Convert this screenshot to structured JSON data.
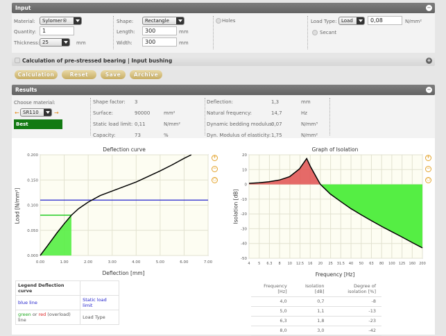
{
  "input": {
    "header": "Input",
    "material_label": "Material:",
    "material_value": "Sylomer®",
    "quantity_label": "Quantity:",
    "quantity_value": "1",
    "thickness_label": "Thickness:",
    "thickness_value": "25",
    "thickness_unit": "mm",
    "shape_label": "Shape:",
    "shape_value": "Rectangle",
    "length_label": "Length:",
    "length_value": "300",
    "length_unit": "mm",
    "width_label": "Width:",
    "width_value": "300",
    "width_unit": "mm",
    "holes_label": "Holes",
    "load_type_label": "Load Type:",
    "load_type_value": "Load",
    "load_value": "0,08",
    "load_unit": "N/mm²",
    "secant_label": "Secant"
  },
  "prestress": {
    "label": "Calculation of pre-stressed bearing | Input bushing"
  },
  "buttons": {
    "calculation": "Calculation",
    "reset": "Reset",
    "save": "Save",
    "archive": "Archive"
  },
  "results": {
    "header": "Results",
    "choose_material_label": "Choose material:",
    "material_value": "SR110",
    "best_label": "Best",
    "col1": [
      {
        "label": "Shape factor:",
        "value": "3",
        "unit": ""
      },
      {
        "label": "Surface:",
        "value": "90000",
        "unit": "mm²"
      },
      {
        "label": "Static load limit:",
        "value": "0,11",
        "unit": "N/mm²"
      },
      {
        "label": "Capacity:",
        "value": "73",
        "unit": "%"
      }
    ],
    "col2": [
      {
        "label": "Deflection:",
        "value": "1,3",
        "unit": "mm"
      },
      {
        "label": "Natural frequency:",
        "value": "14,7",
        "unit": "Hz"
      },
      {
        "label": "Dynamic bedding modulus:",
        "value": "0,07",
        "unit": "N/mm³"
      },
      {
        "label": "Dyn. Modulus of elasticity:",
        "value": "1,75",
        "unit": "N/mm²"
      }
    ]
  },
  "legend": {
    "title": "Legend Deflection curve",
    "row1_left": "blue line",
    "row1_right": "Static load limit",
    "row2_green": "green",
    "row2_or": " or ",
    "row2_red": "red",
    "row2_rest": " (overload) line",
    "row2_right": "Load Type"
  },
  "freq_table": {
    "headers": [
      "Frequency [Hz]",
      "Isolation [dB]",
      "Degree of isolation [%]"
    ],
    "rows": [
      [
        "4,0",
        "0,7",
        "-8"
      ],
      [
        "5,0",
        "1,1",
        "-13"
      ],
      [
        "6,3",
        "1,8",
        "-23"
      ],
      [
        "8,0",
        "3,0",
        "-42"
      ]
    ]
  },
  "colors": {
    "static_limit": "#2222cc",
    "load": "#22cc22",
    "amplification": "#e05050",
    "isolation": "#55ee44"
  },
  "chart_data": [
    {
      "type": "line",
      "title": "Deflection curve",
      "xlabel": "Deflection [mm]",
      "ylabel": "Load [N/mm²]",
      "xlim": [
        0,
        7
      ],
      "ylim": [
        0,
        0.2
      ],
      "xticks": [
        "0.00",
        "1.00",
        "2.00",
        "3.00",
        "4.00",
        "5.00",
        "6.00",
        "7.00"
      ],
      "yticks": [
        "0.000",
        "0.050",
        "0.100",
        "0.150",
        "0.200"
      ],
      "series": [
        {
          "x": [
            0,
            0.3,
            0.7,
            1.0,
            1.3,
            1.6,
            2.0,
            2.5,
            3.0,
            3.5,
            4.0,
            4.5,
            5.0,
            5.5,
            6.0,
            6.3
          ],
          "y": [
            0,
            0.019,
            0.045,
            0.063,
            0.08,
            0.093,
            0.106,
            0.119,
            0.128,
            0.137,
            0.146,
            0.157,
            0.168,
            0.18,
            0.193,
            0.2
          ]
        }
      ],
      "static_load_limit": 0.11,
      "load": 0.08,
      "deflection_at_load": 1.3
    },
    {
      "type": "line",
      "title": "Graph of Isolation",
      "xlabel": "Frequency [Hz]",
      "ylabel": "Isolation [dB]",
      "xticks": [
        "4",
        "5",
        "6.3",
        "8",
        "10",
        "12.5",
        "16",
        "20",
        "25",
        "31.5",
        "40",
        "50",
        "63",
        "80",
        "100",
        "125",
        "160",
        "200"
      ],
      "ylim": [
        -50,
        20
      ],
      "yticks": [
        "20",
        "10",
        "0",
        "-10",
        "-20",
        "-30",
        "-40",
        "-50"
      ],
      "series": [
        {
          "x": [
            4,
            5,
            6.3,
            8,
            10,
            12.5,
            14.7,
            16,
            20,
            25,
            31.5,
            40,
            50,
            63,
            80,
            100,
            125,
            160,
            200
          ],
          "y": [
            0.7,
            1.1,
            1.8,
            3.0,
            5.2,
            10.5,
            17.5,
            12.0,
            0,
            -6.5,
            -11.5,
            -16.5,
            -20.5,
            -24.5,
            -28.5,
            -32,
            -35.5,
            -39.5,
            -43
          ]
        }
      ]
    }
  ]
}
